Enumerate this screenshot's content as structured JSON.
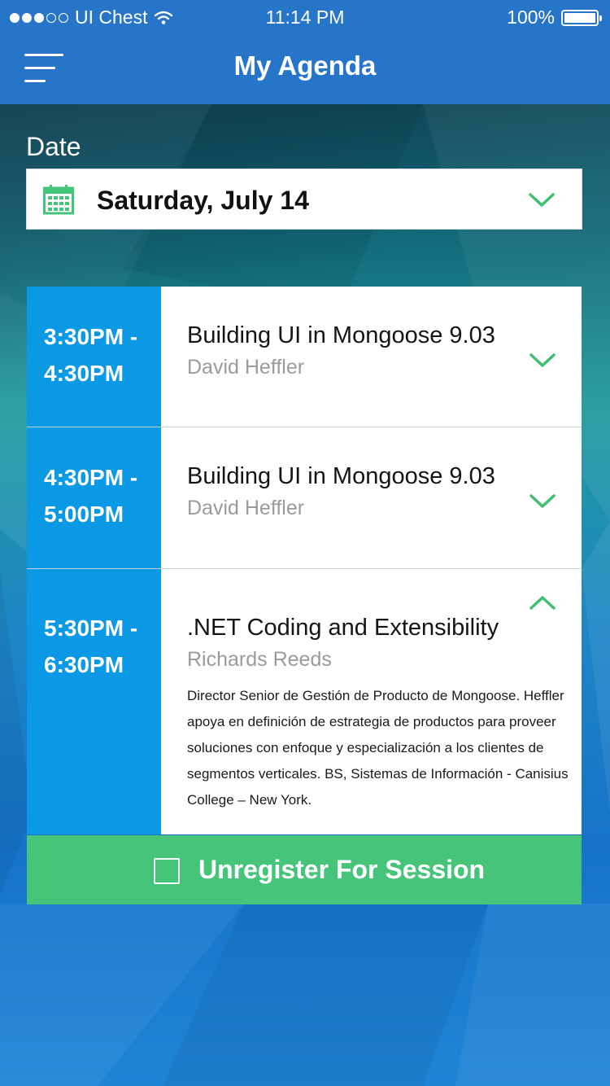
{
  "status_bar": {
    "carrier": "UI Chest",
    "time": "11:14 PM",
    "battery": "100%"
  },
  "header": {
    "title": "My Agenda",
    "menu_icon": "hamburger-menu-icon"
  },
  "date_picker": {
    "label": "Date",
    "selected_value": "Saturday, July 14",
    "icon": "calendar-icon",
    "chevron_icon": "chevron-down-icon"
  },
  "sessions": [
    {
      "time_start": "3:30PM -",
      "time_end": "4:30PM",
      "title": "Building UI in Mongoose 9.03",
      "speaker": "David Heffler",
      "expanded": false
    },
    {
      "time_start": "4:30PM -",
      "time_end": "5:00PM",
      "title": "Building UI in Mongoose 9.03",
      "speaker": "David Heffler",
      "expanded": false
    },
    {
      "time_start": "5:30PM -",
      "time_end": "6:30PM",
      "title": ".NET Coding and Extensibility",
      "speaker": "Richards Reeds",
      "expanded": true,
      "description": "Director Senior de Gestión de Producto de Mongoose. Heffler apoya en definición de estrategia de productos para proveer soluciones con enfoque y especialización a los clientes de segmentos verticales. BS, Sistemas de Información - Canisius College – New York."
    }
  ],
  "unregister_button": {
    "label": "Unregister For Session",
    "checked": false
  },
  "colors": {
    "nav_blue": "#2775c9",
    "time_blue": "#0b98e4",
    "accent_green": "#45c47a",
    "chevron_green": "#3fbf72"
  }
}
